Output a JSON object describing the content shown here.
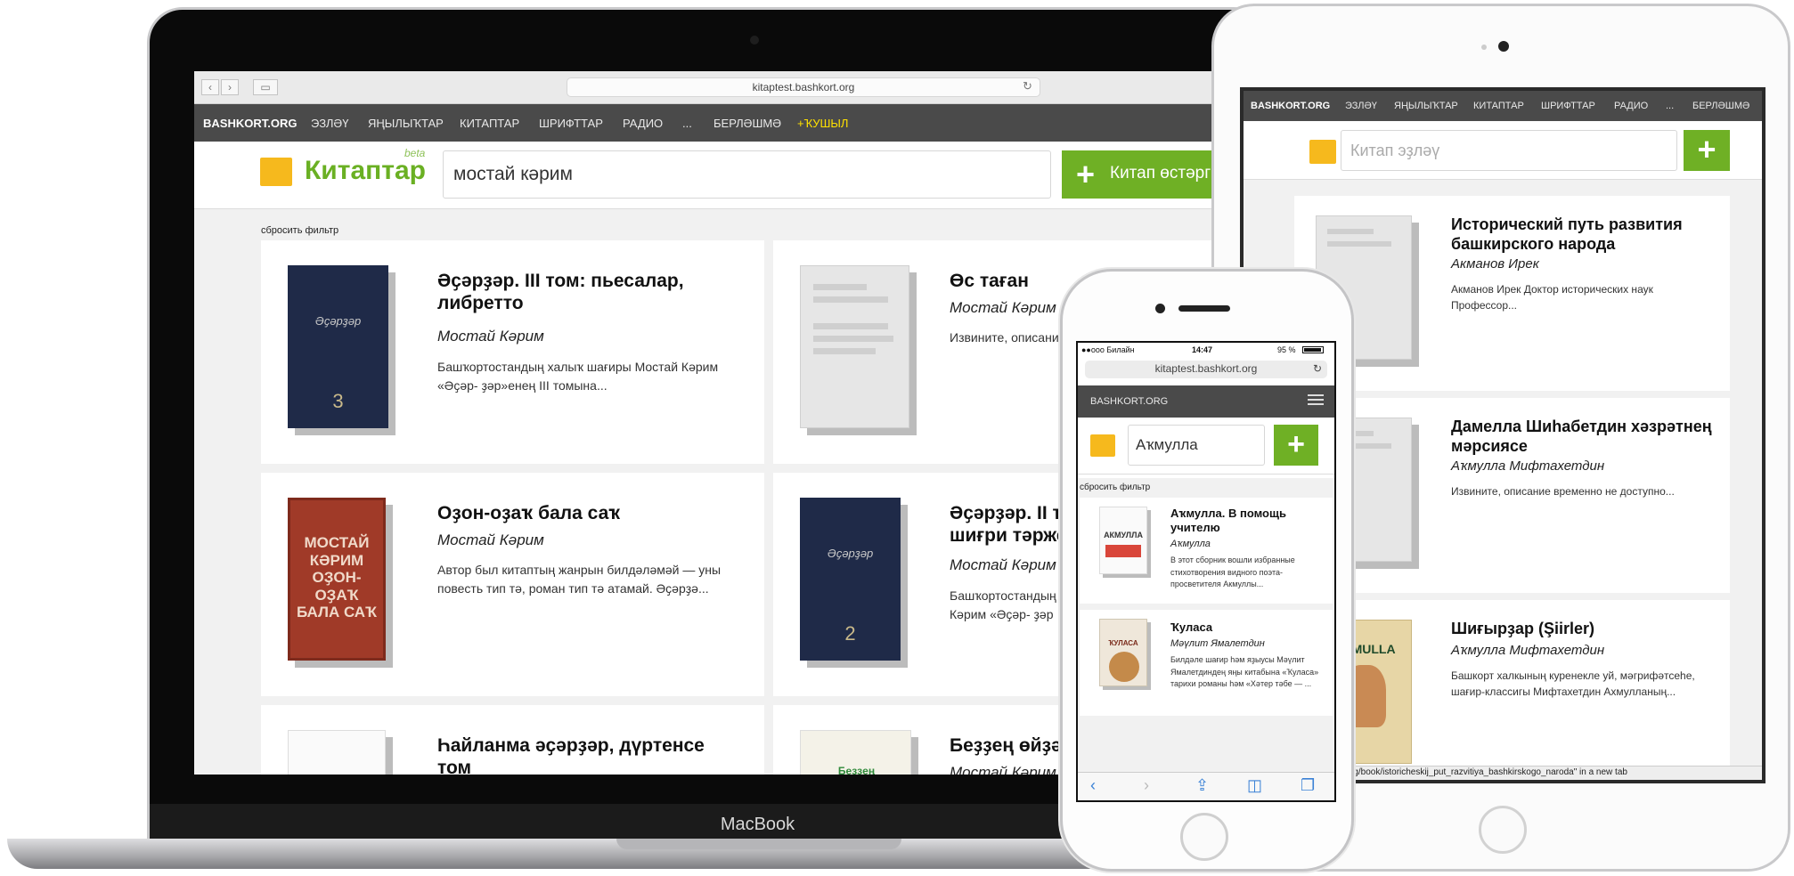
{
  "macbook": {
    "device_label": "MacBook",
    "browser": {
      "url": "kitaptest.bashkort.org",
      "back_glyph": "‹",
      "forward_glyph": "›",
      "sidebar_glyph": "▭",
      "reload_glyph": "↻"
    },
    "nav": {
      "brand": "BASHKORT.ORG",
      "items": [
        "ЭЗЛӘҮ",
        "ЯҢЫЛЫҠТАР",
        "КИТАПТАР",
        "ШРИФТТАР",
        "РАДИО",
        "...",
        "БЕРЛӘШМӘ"
      ],
      "add": "+ҠУШЫЛ"
    },
    "header": {
      "logo": "Китаптар",
      "beta": "beta",
      "search_value": "мостай кәрим",
      "add_button": "Китап өстәрг"
    },
    "reset_filter": "сбросить фильтр",
    "books": [
      {
        "title": "Әҫәрҙәр. III том: пьесалар, либретто",
        "author": "Мостай Кәрим",
        "desc": "Башҡортостандың халыҡ шағиры Мостай Кәрим «Әҫәр- ҙәр»енең III томына...",
        "cover_text": "Әҫәрҙәр",
        "cover_num": "3"
      },
      {
        "title": "Өс таған",
        "author": "Мостай Кәрим",
        "desc": "Извините, описани"
      },
      {
        "title": "Оҙон-оҙаҡ бала саҡ",
        "author": "Мостай Кәрим",
        "desc": "Автор был китаптың жанрын билдәләмәй — уны повесть тип тә, роман тип тә атамай. Әҫәрҙә...",
        "cover_text": "МОСТАЙ КӘРИМ ОҘОН-ОҘАҠ БАЛА САҠ"
      },
      {
        "title": "Әҫәрҙәр. II то шиғри тәржем",
        "author": "Мостай Кәрим",
        "desc": "Башҡортостандың Кәрим «Әҫәр- ҙәр",
        "cover_text": "Әҫәрҙәр",
        "cover_num": "2"
      },
      {
        "title": "Һайланма әҫәрҙәр, дүртенсе том",
        "author": "",
        "desc": ""
      },
      {
        "title": "Беҙҙең өйҙә",
        "author": "Мостай Кәрим",
        "desc": "",
        "cover_text": "Беҙҙең"
      }
    ]
  },
  "ipad": {
    "nav": {
      "brand": "BASHKORT.ORG",
      "items": [
        "ЭЗЛӘҮ",
        "ЯҢЫЛЫҠТАР",
        "КИТАПТАР",
        "ШРИФТТАР",
        "РАДИО",
        "...",
        "БЕРЛӘШМӘ"
      ]
    },
    "search_placeholder": "Китап эҙләү",
    "add_glyph": "+",
    "books": [
      {
        "title": "Исторический путь развития башкирского народа",
        "author": "Акманов Ирек",
        "desc": "Акманов Ирек Доктор исторических наук Профессор..."
      },
      {
        "title": "Дамелла Шиһабетдин хәзрәтнең мәрсиясе",
        "author": "Аҡмулла Мифтахетдин",
        "desc": "Извините, описание временно не доступно..."
      },
      {
        "title": "Шиғырҙар (Şiirler)",
        "author": "Аҡмулла Мифтахетдин",
        "desc": "Башкорт халкының куренекле уй, мәгрифәтсеһе, шағир-классигы Мифтахетдин Ахмулланың...",
        "cover_text": "AKMULLA"
      }
    ],
    "status_link": "rg/book/istoricheskij_put_razvitiya_bashkirskogo_naroda\" in a new tab"
  },
  "iphone": {
    "status": {
      "carrier": "●●ooo Билайн",
      "time": "14:47",
      "battery": "95 %"
    },
    "url": "kitaptest.bashkort.org",
    "brand": "BASHKORT.ORG",
    "search_value": "Аҡмулла",
    "add_glyph": "+",
    "reset_filter": "сбросить фильтр",
    "books": [
      {
        "title": "Аҡмулла. В помощь учителю",
        "author": "Аҡмулла",
        "desc": "В этот сборник вошли избранные стихотворения видного поэта-просветителя Акмуллы...",
        "cover_text": "АКМУЛЛА"
      },
      {
        "title": "Ҡуласа",
        "author": "Мәүлит Ямалетдин",
        "desc": "Билдәле шағир һәм яҙыусы Мәүлит Ямалетдиндең яңы китабына «Ҡуласа» тарихи романы һәм «Хәтер тәбе — ...",
        "cover_text": "ҠУЛАСА"
      }
    ],
    "toolbar": {
      "back": "‹",
      "forward": "›",
      "share": "⇪",
      "bookmarks": "◫",
      "tabs": "❐"
    }
  },
  "colors": {
    "accent_green": "#6fb025",
    "nav_bg": "#4a4a4a",
    "logo_yellow": "#f6b91d",
    "add_link": "#ffe100"
  }
}
